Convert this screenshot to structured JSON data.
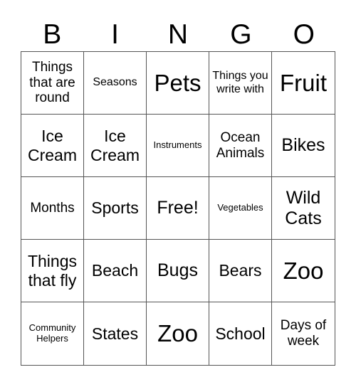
{
  "title": {
    "letters": [
      "B",
      "I",
      "N",
      "G",
      "O"
    ]
  },
  "board": {
    "rows": [
      [
        {
          "text": "Things that are round",
          "size": "md"
        },
        {
          "text": "Seasons",
          "size": "sm"
        },
        {
          "text": "Pets",
          "size": "xxl"
        },
        {
          "text": "Things you write with",
          "size": "sm"
        },
        {
          "text": "Fruit",
          "size": "xxl"
        }
      ],
      [
        {
          "text": "Ice Cream",
          "size": "lg"
        },
        {
          "text": "Ice Cream",
          "size": "lg"
        },
        {
          "text": "Instruments",
          "size": "xs"
        },
        {
          "text": "Ocean Animals",
          "size": "md"
        },
        {
          "text": "Bikes",
          "size": "xl"
        }
      ],
      [
        {
          "text": "Months",
          "size": "md"
        },
        {
          "text": "Sports",
          "size": "lg"
        },
        {
          "text": "Free!",
          "size": "xl"
        },
        {
          "text": "Vegetables",
          "size": "xs"
        },
        {
          "text": "Wild Cats",
          "size": "xl"
        }
      ],
      [
        {
          "text": "Things that fly",
          "size": "lg"
        },
        {
          "text": "Beach",
          "size": "lg"
        },
        {
          "text": "Bugs",
          "size": "xl"
        },
        {
          "text": "Bears",
          "size": "lg"
        },
        {
          "text": "Zoo",
          "size": "xxl"
        }
      ],
      [
        {
          "text": "Community Helpers",
          "size": "xs"
        },
        {
          "text": "States",
          "size": "lg"
        },
        {
          "text": "Zoo",
          "size": "xxl"
        },
        {
          "text": "School",
          "size": "lg"
        },
        {
          "text": "Days of week",
          "size": "md"
        }
      ]
    ]
  }
}
